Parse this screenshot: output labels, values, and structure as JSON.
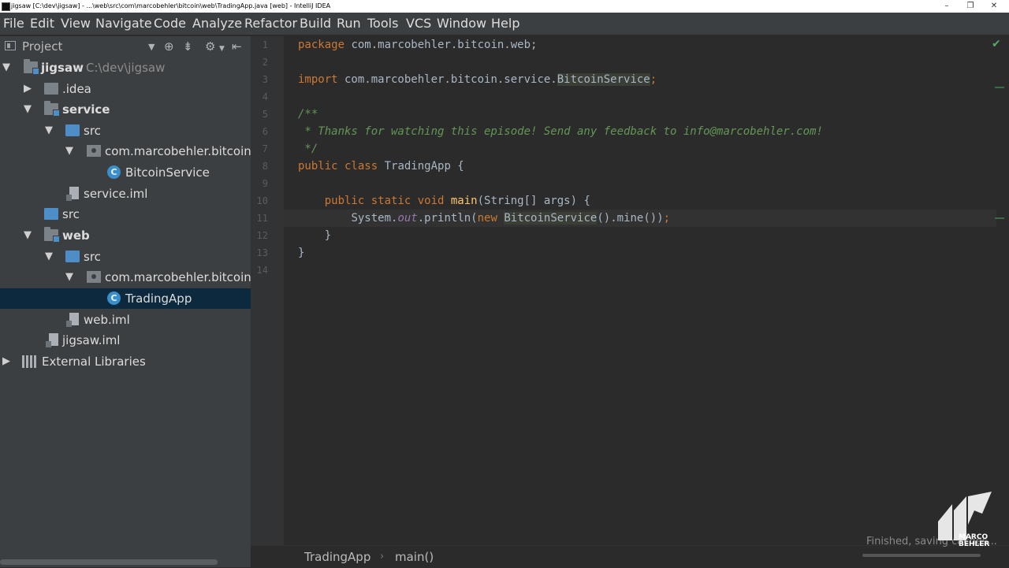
{
  "window": {
    "title": "jigsaw [C:\\dev\\jigsaw] - ...\\web\\src\\com\\marcobehler\\bitcoin\\web\\TradingApp.java [web] - IntelliJ IDEA",
    "minimize_glyph": "–",
    "maximize_glyph": "❐",
    "close_glyph": "✕"
  },
  "menu": [
    "File",
    "Edit",
    "View",
    "Navigate",
    "Code",
    "Analyze",
    "Refactor",
    "Build",
    "Run",
    "Tools",
    "VCS",
    "Window",
    "Help"
  ],
  "project": {
    "label": "Project",
    "tree": [
      {
        "label": "jigsaw",
        "path": "C:\\dev\\jigsaw",
        "bold": true
      },
      {
        "label": ".idea"
      },
      {
        "label": "service",
        "bold": true
      },
      {
        "label": "src"
      },
      {
        "label": "com.marcobehler.bitcoin.service"
      },
      {
        "label": "BitcoinService"
      },
      {
        "label": "service.iml"
      },
      {
        "label": "src"
      },
      {
        "label": "web",
        "bold": true
      },
      {
        "label": "src"
      },
      {
        "label": "com.marcobehler.bitcoin.web"
      },
      {
        "label": "TradingApp"
      },
      {
        "label": "web.iml"
      },
      {
        "label": "jigsaw.iml"
      },
      {
        "label": "External Libraries"
      }
    ]
  },
  "editor": {
    "line_numbers": [
      "1",
      "2",
      "3",
      "4",
      "5",
      "6",
      "7",
      "8",
      "9",
      "10",
      "11",
      "12",
      "13",
      "14"
    ],
    "code": {
      "l1_kw": "package",
      "l1_rest": " com.marcobehler.bitcoin.web;",
      "l3_kw": "import",
      "l3_pkg": " com.marcobehler.bitcoin.service.",
      "l3_cls": "BitcoinService",
      "l3_semi": ";",
      "l5": "/**",
      "l6": " * Thanks for watching this episode! Send any feedback to info@marcobehler.com!",
      "l7": " */",
      "l8_kw": "public class",
      "l8_rest": " TradingApp {",
      "l10_indent": "    ",
      "l10_kw": "public static void",
      "l10_sp": " ",
      "l10_fn": "main",
      "l10_rest": "(String[] args) {",
      "l11_indent": "        ",
      "l11_a": "System.",
      "l11_out": "out",
      "l11_b": ".println(",
      "l11_new": "new",
      "l11_sp": " ",
      "l11_cls": "BitcoinService",
      "l11_c": "().mine())",
      "l11_semi": ";",
      "l12": "    }",
      "l13": "}"
    }
  },
  "breadcrumb": {
    "class": "TradingApp",
    "method": "main()"
  },
  "status": {
    "text": "Finished, saving caches..."
  },
  "logo": {
    "line1": "MARCO",
    "line2": "BEHLER"
  },
  "colors": {
    "keyword": "#cc7832",
    "comment": "#629755",
    "function": "#ffc66d",
    "static_field": "#9876aa",
    "selection": "#0d293e"
  }
}
